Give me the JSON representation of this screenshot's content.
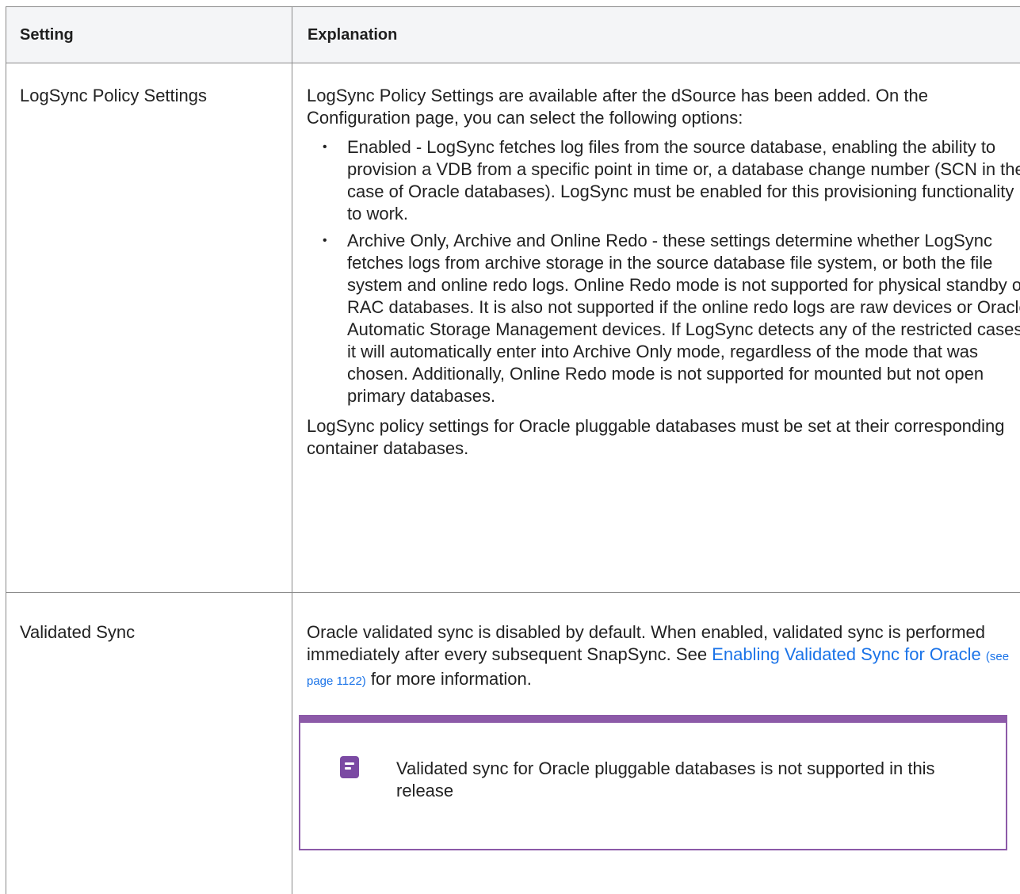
{
  "table": {
    "headers": [
      "Setting",
      "Explanation"
    ],
    "rows": [
      {
        "setting": "LogSync Policy Settings",
        "intro": "LogSync Policy Settings are available after the dSource has been added. On the Configuration page, you can select the following options:",
        "options": [
          "Enabled - LogSync fetches log files from the source database, enabling the ability to provision a VDB from a specific point in time or, a database change number (SCN in the case of Oracle databases). LogSync must be enabled for this provisioning functionality to work.",
          "Archive Only, Archive and Online Redo - these settings determine whether LogSync fetches logs from archive storage in the source database file system, or both the file system and online redo logs. Online Redo mode is not supported for physical standby or RAC databases. It is also not supported if the online redo logs are raw devices or Oracle Automatic Storage Management devices. If LogSync detects any of the restricted cases it will automatically enter into Archive Only mode, regardless of the mode that was chosen. Additionally, Online Redo mode is not supported for mounted but not open primary databases."
        ],
        "outro": "LogSync policy settings for Oracle pluggable databases must be set at their corresponding container databases."
      },
      {
        "setting": "Validated Sync",
        "text_before": "Oracle validated sync is disabled by default. When enabled, validated sync is performed immediately after every subsequent SnapSync. See ",
        "link_text": "Enabling Validated Sync for Oracle",
        "link_page": "(see page 1122)",
        "text_after": " for more information.",
        "note": "Validated sync for Oracle pluggable databases is not supported in this release"
      }
    ]
  },
  "colors": {
    "link": "#1a73e8",
    "note_accent": "#8c5aa8",
    "header_bg": "#f4f5f7"
  },
  "icons": {
    "note": "note-icon",
    "bullet": "•"
  }
}
